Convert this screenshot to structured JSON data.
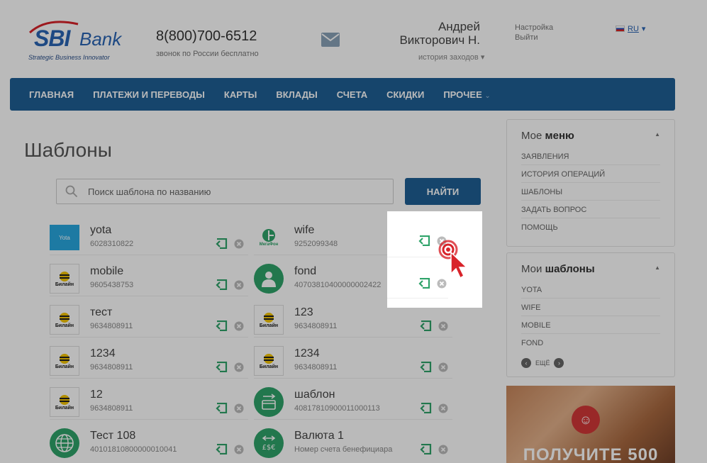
{
  "header": {
    "logo_brand": "SBI",
    "logo_bank": "Bank",
    "logo_tagline": "Strategic Business Innovator",
    "phone": "8(800)700-6512",
    "phone_note": "звонок по России бесплатно",
    "user_first": "Андрей",
    "user_last": "Викторович Н.",
    "history_link": "история заходов",
    "settings_link": "Настройка",
    "logout_link": "Выйти",
    "language": "RU"
  },
  "nav": {
    "items": [
      "ГЛАВНАЯ",
      "ПЛАТЕЖИ И ПЕРЕВОДЫ",
      "КАРТЫ",
      "ВКЛАДЫ",
      "СЧЕТА",
      "СКИДКИ",
      "ПРОЧЕЕ"
    ]
  },
  "page": {
    "title": "Шаблоны",
    "search_placeholder": "Поиск шаблона по названию",
    "find_button": "НАЙТИ"
  },
  "templates": {
    "left": [
      {
        "name": "yota",
        "account": "6028310822",
        "logo": "yota-logo",
        "logo_text": "Yota"
      },
      {
        "name": "mobile",
        "account": "9605438753",
        "logo": "beeline-logo",
        "logo_text": "Билайн"
      },
      {
        "name": "тест",
        "account": "9634808911",
        "logo": "beeline-logo",
        "logo_text": "Билайн"
      },
      {
        "name": "1234",
        "account": "9634808911",
        "logo": "beeline-logo",
        "logo_text": "Билайн"
      },
      {
        "name": "12",
        "account": "9634808911",
        "logo": "beeline-logo",
        "logo_text": "Билайн"
      },
      {
        "name": "Тест 108",
        "account": "40101810800000010041",
        "logo": "globe-icon"
      }
    ],
    "right": [
      {
        "name": "wife",
        "account": "9252099348",
        "logo": "megafon-logo",
        "logo_text": "МегаФон"
      },
      {
        "name": "fond",
        "account": "40703810400000002422",
        "logo": "person-icon"
      },
      {
        "name": "123",
        "account": "9634808911",
        "logo": "beeline-logo",
        "logo_text": "Билайн"
      },
      {
        "name": "1234",
        "account": "9634808911",
        "logo": "beeline-logo",
        "logo_text": "Билайн"
      },
      {
        "name": "шаблон",
        "account": "40817810900011000113",
        "logo": "transfer-card-icon"
      },
      {
        "name": "Валюта 1",
        "account": "Номер счета бенефициара",
        "logo": "currency-exchange-icon"
      }
    ]
  },
  "sidebar": {
    "menu_title_prefix": "Мое",
    "menu_title_bold": "меню",
    "menu_items": [
      "ЗАЯВЛЕНИЯ",
      "ИСТОРИЯ ОПЕРАЦИЙ",
      "ШАБЛОНЫ",
      "ЗАДАТЬ ВОПРОС",
      "ПОМОЩЬ"
    ],
    "templates_title_prefix": "Мои",
    "templates_title_bold": "шаблоны",
    "template_items": [
      "YOTA",
      "WIFE",
      "MOBILE",
      "FOND"
    ],
    "more_label": "ЕЩЁ"
  },
  "promo": {
    "text": "ПОЛУЧИТЕ 500"
  },
  "colors": {
    "brand_blue": "#1f5f95",
    "logo_blue": "#2a64b4",
    "action_green": "#2fa36a",
    "highlight_red": "#d8232a"
  }
}
